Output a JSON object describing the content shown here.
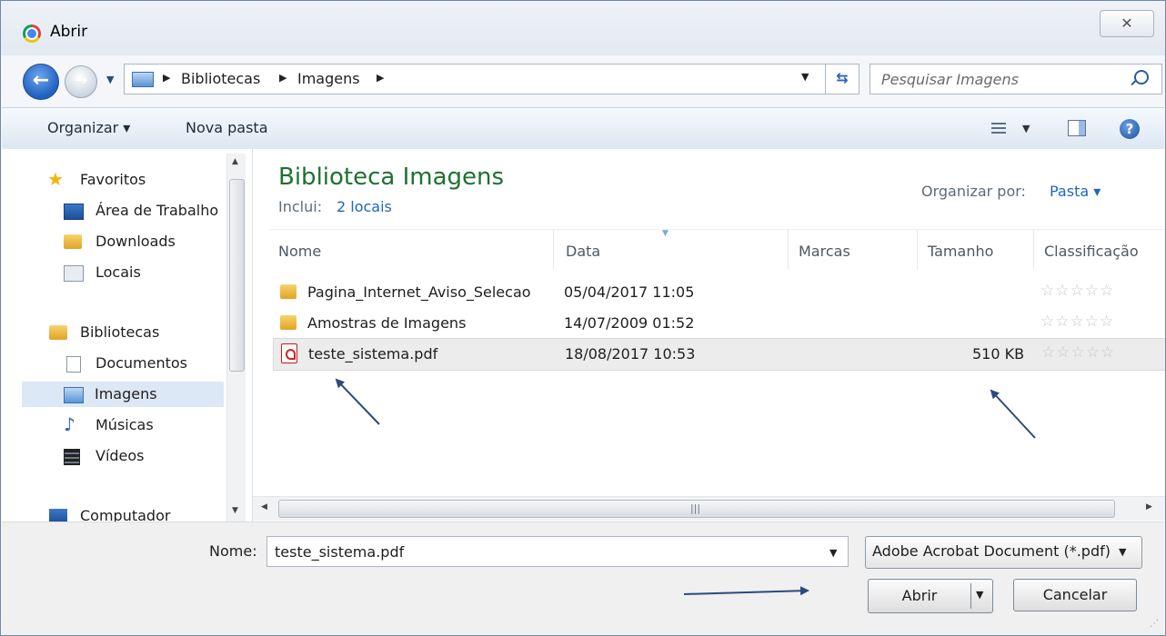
{
  "window": {
    "title": "Abrir",
    "close_glyph": "✕"
  },
  "nav": {
    "breadcrumbs": [
      "Bibliotecas",
      "Imagens"
    ],
    "search_placeholder": "Pesquisar Imagens"
  },
  "toolbar": {
    "organize_label": "Organizar ▾",
    "new_folder_label": "Nova pasta",
    "help_glyph": "?"
  },
  "sidebar": {
    "favorites_header": "Favoritos",
    "favorites": [
      "Área de Trabalho",
      "Downloads",
      "Locais"
    ],
    "libraries_header": "Bibliotecas",
    "libraries": [
      "Documentos",
      "Imagens",
      "Músicas",
      "Vídeos"
    ],
    "selected": "Imagens",
    "computer_label": "Computador"
  },
  "library": {
    "title": "Biblioteca Imagens",
    "includes_label": "Inclui:",
    "includes_link": "2 locais",
    "arrange_label": "Organizar por:",
    "arrange_value": "Pasta ▾"
  },
  "table": {
    "columns": [
      "Nome",
      "Data",
      "Marcas",
      "Tamanho",
      "Classificação"
    ],
    "rows": [
      {
        "name": "Pagina_Internet_Aviso_Selecao",
        "date": "05/04/2017 11:05",
        "size": "",
        "type": "folder",
        "rating": "☆☆☆☆☆"
      },
      {
        "name": "Amostras de Imagens",
        "date": "14/07/2009 01:52",
        "size": "",
        "type": "folder",
        "rating": "☆☆☆☆☆"
      },
      {
        "name": "teste_sistema.pdf",
        "date": "18/08/2017 10:53",
        "size": "510 KB",
        "type": "pdf",
        "rating": "☆☆☆☆☆"
      }
    ],
    "selected_row": 2
  },
  "bottom": {
    "name_label": "Nome:",
    "name_value": "teste_sistema.pdf",
    "filter_value": "Adobe Acrobat Document (*.pdf)",
    "open_label": "Abrir",
    "cancel_label": "Cancelar"
  },
  "colors": {
    "library_title": "#1e7130",
    "link": "#1f66bf",
    "annotation_arrow": "#2c4a7c",
    "selection": "#ececec"
  }
}
